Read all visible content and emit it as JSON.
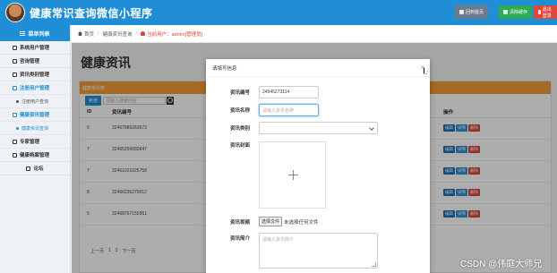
{
  "header": {
    "title": "健康常识查询微信小程序",
    "buttons": {
      "home": "回到首页",
      "cache": "清除缓存",
      "exit": "退出登录"
    }
  },
  "sidebar": {
    "heading": "菜单列表",
    "items": [
      {
        "label": "系统用户管理",
        "type": "group"
      },
      {
        "label": "咨询管理",
        "type": "group"
      },
      {
        "label": "资讯类别管理",
        "type": "group"
      },
      {
        "label": "注册用户管理",
        "type": "group",
        "active": true
      },
      {
        "label": "注册用户查询",
        "type": "sub"
      },
      {
        "label": "健康资讯管理",
        "type": "group",
        "active": true
      },
      {
        "label": "健康资讯查询",
        "type": "sub",
        "active": true
      },
      {
        "label": "专家管理",
        "type": "group"
      },
      {
        "label": "健康档案管理",
        "type": "group"
      },
      {
        "label": "论坛",
        "type": "center"
      }
    ]
  },
  "breadcrumb": {
    "home": "首页",
    "current": "健康资讯查询",
    "user_prefix": "当前用户：",
    "user": "admin[管理员]"
  },
  "main": {
    "title": "健康资讯",
    "panel_head": "健康资讯表",
    "add_label": "新增",
    "search_placeholder": "请输入搜索内容",
    "columns": [
      "ID",
      "资讯编号",
      "操作"
    ],
    "rows": [
      {
        "id": "6",
        "code": "32467985263673"
      },
      {
        "id": "7",
        "code": "32465250683647"
      },
      {
        "id": "7",
        "code": "32461021025758"
      },
      {
        "id": "8",
        "code": "32466236279012"
      },
      {
        "id": "5",
        "code": "32468767155951"
      }
    ],
    "ops": {
      "edit": "编辑",
      "detail": "详情",
      "delete": "删除"
    },
    "pager": [
      "上一页",
      "1",
      "2",
      "下一页"
    ]
  },
  "modal": {
    "title": "请填写信息",
    "close": "×",
    "fields": {
      "code_label": "资讯编号",
      "code_value": "24545273114",
      "name_label": "资讯名称",
      "name_placeholder": "请输入资讯名称",
      "category_label": "资讯类别",
      "cover_label": "资讯封面",
      "video_label": "资讯视频",
      "file_button": "选择文件",
      "file_status": "未选择任何文件",
      "intro_label": "资讯简介",
      "intro_placeholder": "请输入资讯简介"
    }
  },
  "watermark": "CSDN @伟庭大师兄",
  "colors": {
    "primary": "#1f8ed6",
    "orange": "#f39c34",
    "danger": "#d9463a",
    "success": "#2eab54"
  }
}
